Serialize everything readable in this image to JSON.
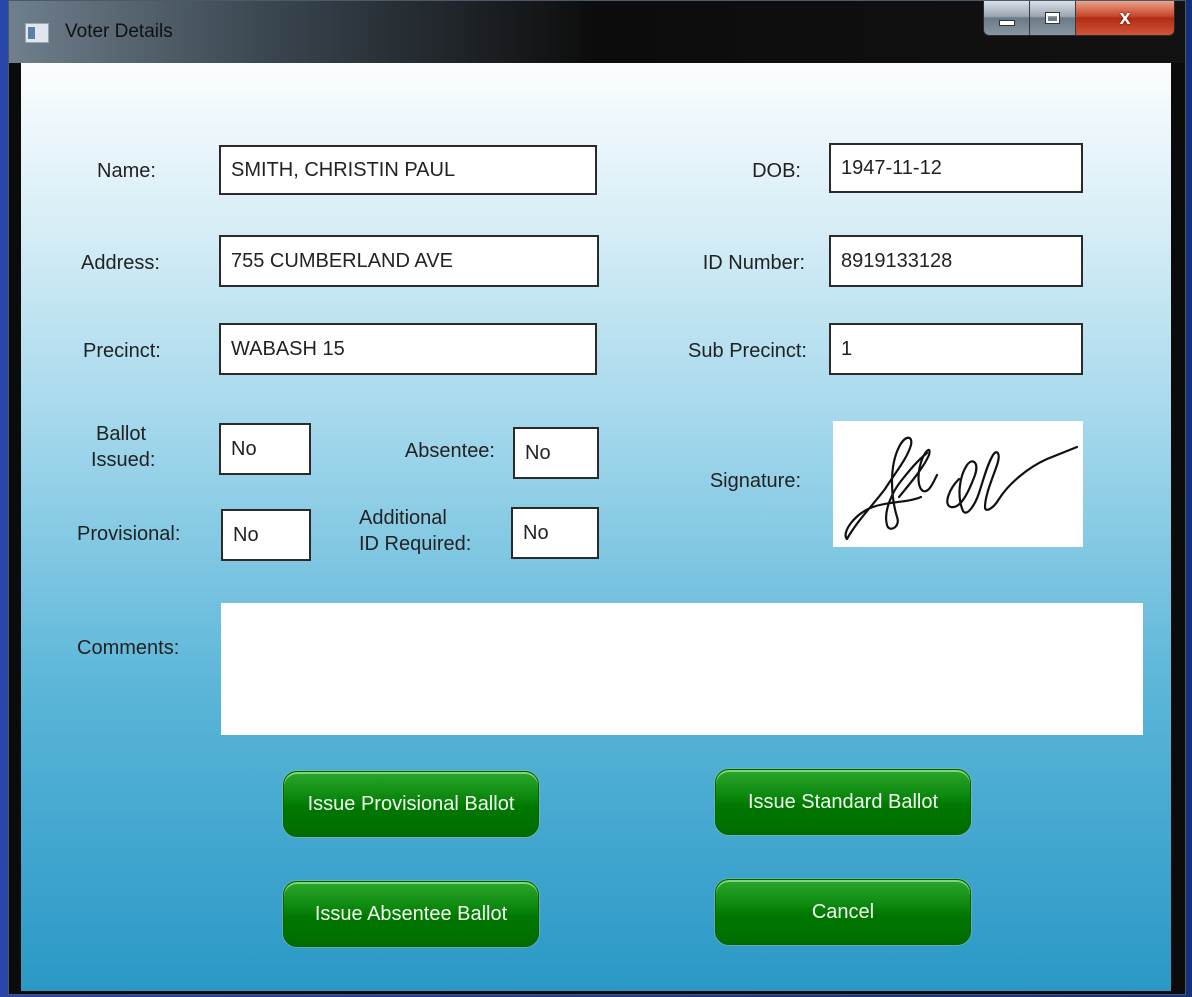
{
  "window": {
    "title": "Voter Details",
    "close_glyph": "x"
  },
  "labels": {
    "name": "Name:",
    "address": "Address:",
    "precinct": "Precinct:",
    "dob": "DOB:",
    "id_number": "ID Number:",
    "sub_precinct": "Sub Precinct:",
    "ballot_issued_line1": "Ballot",
    "ballot_issued_line2": "Issued:",
    "absentee": "Absentee:",
    "provisional": "Provisional:",
    "additional_id_line1": "Additional",
    "additional_id_line2": "ID Required:",
    "signature": "Signature:",
    "comments": "Comments:"
  },
  "fields": {
    "name": "SMITH, CHRISTIN PAUL",
    "address": "755 CUMBERLAND AVE",
    "precinct": "WABASH 15",
    "dob": "1947-11-12",
    "id_number": "8919133128",
    "sub_precinct": "1",
    "ballot_issued": "No",
    "absentee": "No",
    "provisional": "No",
    "additional_id_required": "No",
    "comments": ""
  },
  "buttons": {
    "issue_provisional": "Issue Provisional Ballot",
    "issue_standard": "Issue Standard Ballot",
    "issue_absentee": "Issue Absentee Ballot",
    "cancel": "Cancel"
  },
  "icons": {
    "app": "window-app-icon",
    "minimize": "minimize-icon",
    "maximize": "maximize-icon",
    "close": "close-icon"
  },
  "colors": {
    "button_green": "#007800",
    "client_top": "#fbfdfe",
    "client_bottom": "#2a98c6",
    "close_red": "#c7452a"
  }
}
